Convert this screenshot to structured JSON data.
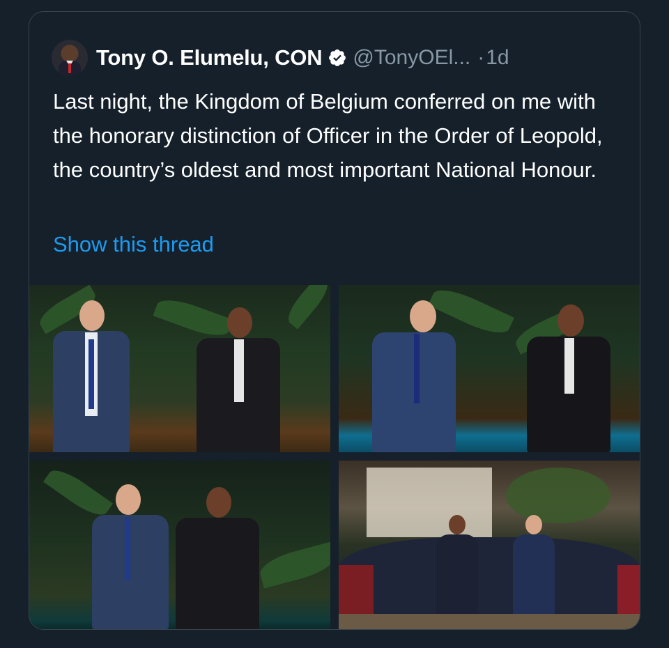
{
  "tweet": {
    "display_name": "Tony O. Elumelu, CON",
    "handle": "@TonyOEl...",
    "separator": "·",
    "time": "1d",
    "text": "Last night, the Kingdom of Belgium conferred on me with the honorary distinction of Officer in the Order of Leopold, the country’s oldest and most important National Honour.",
    "show_thread_label": "Show this thread"
  },
  "icons": {
    "verified": "verified-badge-icon",
    "avatar": "profile-avatar"
  },
  "colors": {
    "background": "#15202b",
    "border": "#38444d",
    "text_primary": "#ffffff",
    "text_secondary": "#8899a6",
    "link": "#1d9bf0"
  },
  "photos": [
    {
      "label": "photo-1"
    },
    {
      "label": "photo-2"
    },
    {
      "label": "photo-3"
    },
    {
      "label": "photo-4"
    }
  ]
}
